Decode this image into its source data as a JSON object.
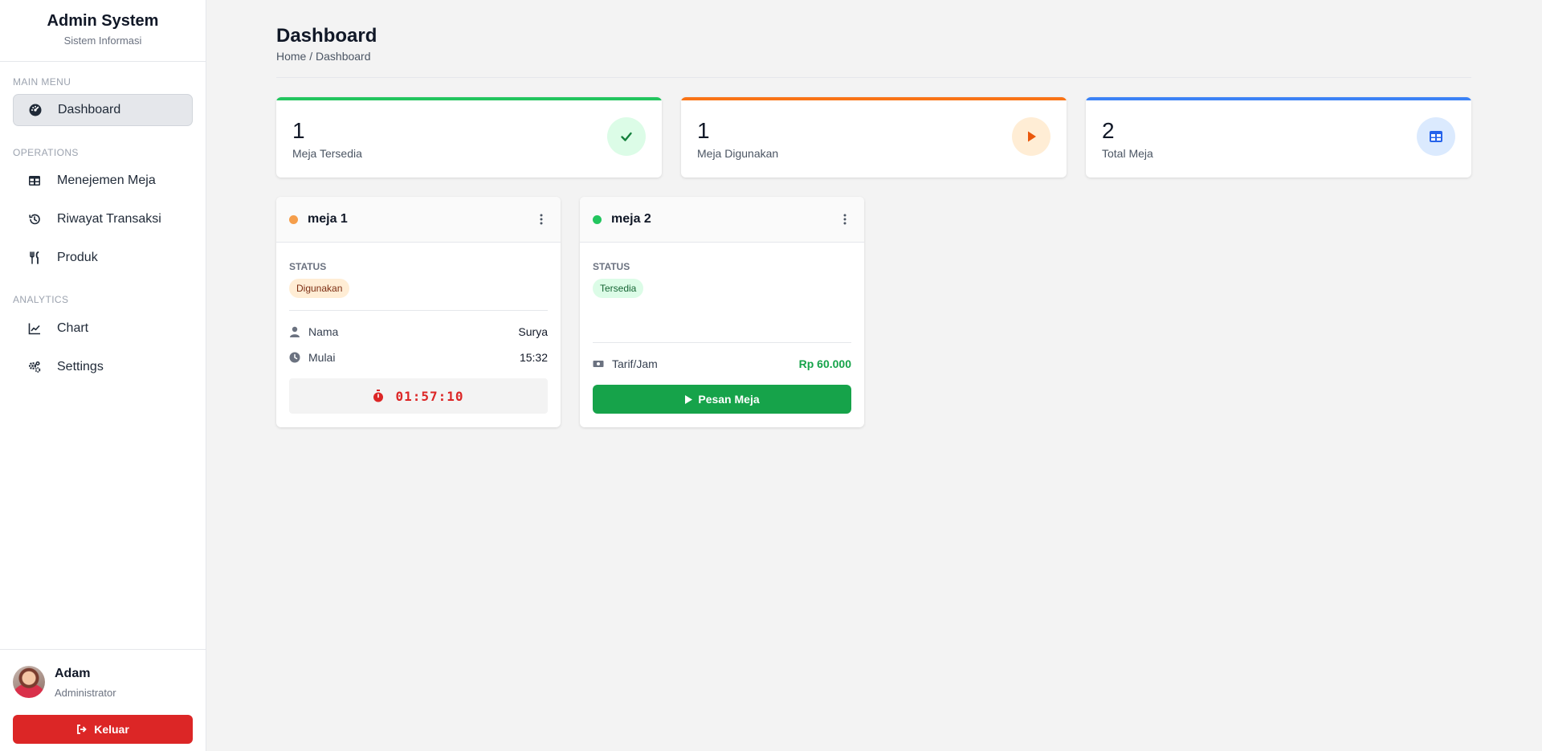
{
  "brand": {
    "title": "Admin System",
    "subtitle": "Sistem Informasi"
  },
  "sidebar": {
    "sections": [
      {
        "label": "MAIN MENU"
      },
      {
        "label": "OPERATIONS"
      },
      {
        "label": "ANALYTICS"
      }
    ],
    "items": [
      {
        "label": "Dashboard",
        "icon": "gauge-icon",
        "active": true
      },
      {
        "label": "Menejemen Meja",
        "icon": "table-icon"
      },
      {
        "label": "Riwayat Transaksi",
        "icon": "history-icon"
      },
      {
        "label": "Produk",
        "icon": "utensils-icon"
      },
      {
        "label": "Chart",
        "icon": "line-chart-icon"
      },
      {
        "label": "Settings",
        "icon": "gears-icon"
      }
    ]
  },
  "user": {
    "name": "Adam",
    "role": "Administrator",
    "logout_label": "Keluar"
  },
  "header": {
    "title": "Dashboard",
    "breadcrumb": "Home / Dashboard"
  },
  "stats": [
    {
      "value": "1",
      "label": "Meja Tersedia",
      "color": "#22c55e",
      "icon": "check-icon"
    },
    {
      "value": "1",
      "label": "Meja Digunakan",
      "color": "#f97316",
      "icon": "play-icon"
    },
    {
      "value": "2",
      "label": "Total Meja",
      "color": "#3b82f6",
      "icon": "table-icon"
    }
  ],
  "tables": [
    {
      "name": "meja 1",
      "status_label": "STATUS",
      "status": "Digunakan",
      "status_color": "#f59e4b",
      "name_label": "Nama",
      "customer": "Surya",
      "start_label": "Mulai",
      "start_time": "15:32",
      "timer": "01:57:10"
    },
    {
      "name": "meja 2",
      "status_label": "STATUS",
      "status": "Tersedia",
      "status_color": "#22c55e",
      "rate_label": "Tarif/Jam",
      "rate": "Rp 60.000",
      "button_label": "Pesan Meja"
    }
  ]
}
